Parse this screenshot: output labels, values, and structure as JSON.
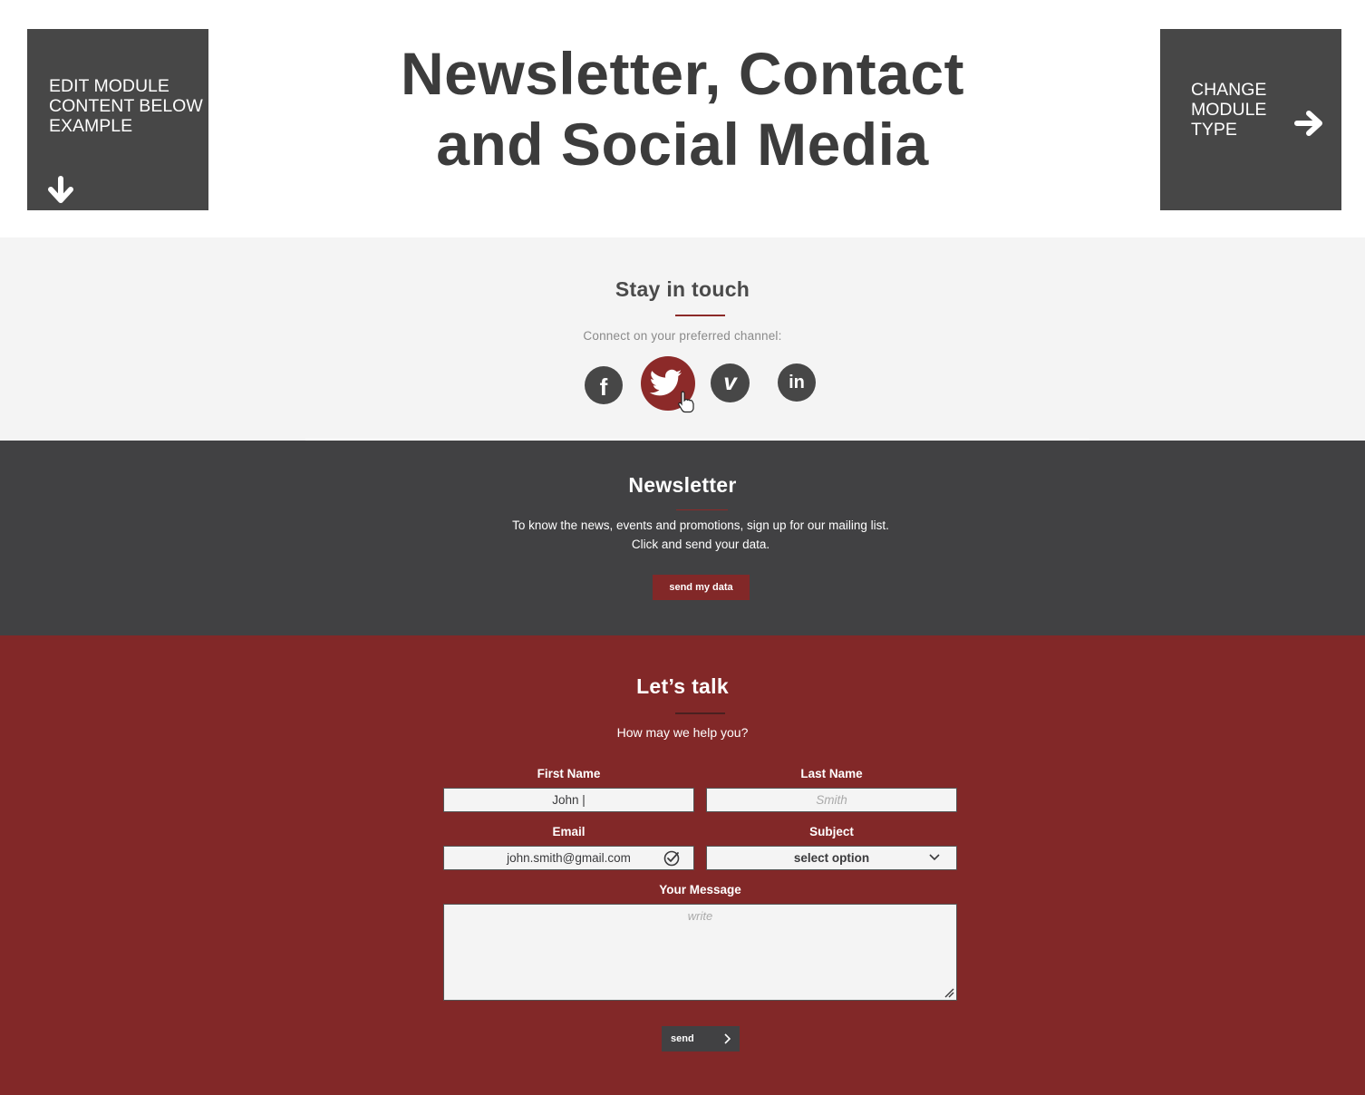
{
  "header": {
    "edit_module": "EDIT MODULE CONTENT BELOW EXAMPLE",
    "title_line1": "Newsletter, Contact",
    "title_line2": "and Social Media",
    "change_module": "CHANGE MODULE TYPE"
  },
  "social": {
    "title": "Stay in touch",
    "subtitle": "Connect on your preferred channel:",
    "icons": [
      "facebook-icon",
      "twitter-icon",
      "vimeo-icon",
      "linkedin-icon"
    ],
    "active_icon": "twitter-icon"
  },
  "newsletter": {
    "title": "Newsletter",
    "description": "To know the news, events and promotions, sign up for our mailing list. Click and send your data.",
    "button_label": "send my data"
  },
  "contact": {
    "title": "Let’s talk",
    "subtitle": "How may we help you?",
    "first_name_label": "First Name",
    "first_name_value": "John |",
    "last_name_label": "Last Name",
    "last_name_placeholder": "Smith",
    "email_label": "Email",
    "email_value": "john.smith@gmail.com",
    "subject_label": "Subject",
    "subject_value": "select option",
    "message_label": "Your Message",
    "message_placeholder": "write",
    "send_label": "send"
  },
  "colors": {
    "accent_red": "#822828",
    "dark_gray": "#414143",
    "box_gray": "#474747",
    "light_bg": "#f4f4f4"
  }
}
